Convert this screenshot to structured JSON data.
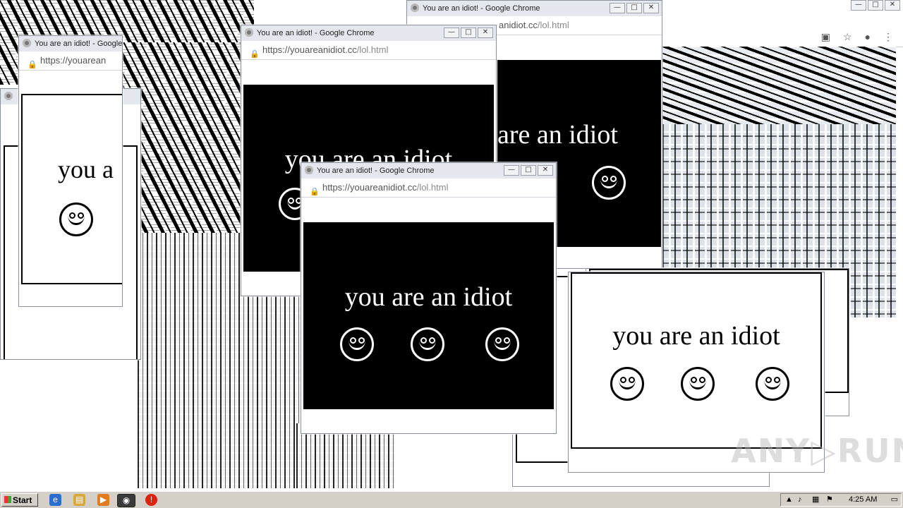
{
  "window_title": "You are an idiot! - Google Chrome",
  "url_host": "https://youareanidiot.cc",
  "url_path": "/lol.html",
  "url_host_partial_1": "https://youarean",
  "url_host_partial_2": "anidiot.cc",
  "message": "you are an idiot",
  "message_partial_1": "you a",
  "message_partial_2": "are an idiot",
  "win_buttons": {
    "minimize": "—",
    "maximize": "□",
    "close": "✕"
  },
  "background_browser": {
    "buttons": {
      "minimize": "—",
      "maximize": "□",
      "close": "✕"
    },
    "icons": [
      "cast-icon",
      "star-icon",
      "profile-icon",
      "menu-icon"
    ]
  },
  "taskbar": {
    "start_label": "Start",
    "clock": "4:25 AM",
    "pinned": [
      "ie-icon",
      "explorer-icon",
      "media-player-icon",
      "chrome-icon",
      "alert-icon"
    ]
  },
  "watermark": "ANY▷RUN",
  "colors": {
    "black": "#000000",
    "white": "#ffffff",
    "titlebar": "#e4e8ee"
  }
}
